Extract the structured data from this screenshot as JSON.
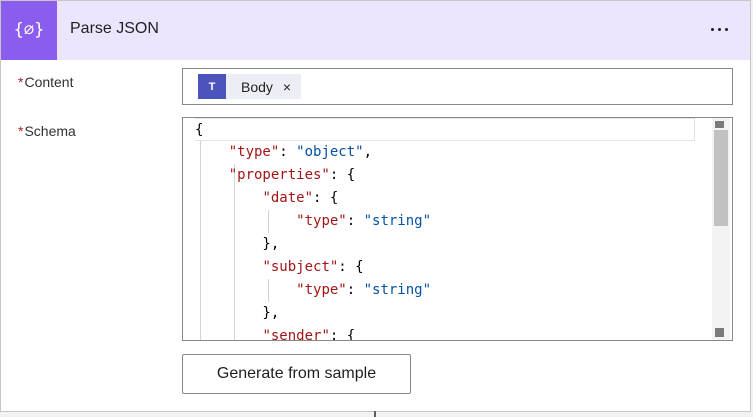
{
  "header": {
    "icon_glyph": "{⌀}",
    "title": "Parse JSON",
    "menu_icon": "more-horizontal-icon"
  },
  "fields": {
    "content": {
      "required_mark": "*",
      "label": "Content",
      "token": {
        "icon": "teams-icon",
        "label": "Body",
        "remove_glyph": "×"
      }
    },
    "schema": {
      "required_mark": "*",
      "label": "Schema",
      "code_lines": [
        [
          {
            "t": "p",
            "v": "{"
          }
        ],
        [
          {
            "t": "p",
            "v": "    "
          },
          {
            "t": "k",
            "v": "\"type\""
          },
          {
            "t": "p",
            "v": ": "
          },
          {
            "t": "s",
            "v": "\"object\""
          },
          {
            "t": "p",
            "v": ","
          }
        ],
        [
          {
            "t": "p",
            "v": "    "
          },
          {
            "t": "k",
            "v": "\"properties\""
          },
          {
            "t": "p",
            "v": ": {"
          }
        ],
        [
          {
            "t": "p",
            "v": "        "
          },
          {
            "t": "k",
            "v": "\"date\""
          },
          {
            "t": "p",
            "v": ": {"
          }
        ],
        [
          {
            "t": "p",
            "v": "            "
          },
          {
            "t": "k",
            "v": "\"type\""
          },
          {
            "t": "p",
            "v": ": "
          },
          {
            "t": "s",
            "v": "\"string\""
          }
        ],
        [
          {
            "t": "p",
            "v": "        },"
          }
        ],
        [
          {
            "t": "p",
            "v": "        "
          },
          {
            "t": "k",
            "v": "\"subject\""
          },
          {
            "t": "p",
            "v": ": {"
          }
        ],
        [
          {
            "t": "p",
            "v": "            "
          },
          {
            "t": "k",
            "v": "\"type\""
          },
          {
            "t": "p",
            "v": ": "
          },
          {
            "t": "s",
            "v": "\"string\""
          }
        ],
        [
          {
            "t": "p",
            "v": "        },"
          }
        ],
        [
          {
            "t": "p",
            "v": "        "
          },
          {
            "t": "k",
            "v": "\"sender\""
          },
          {
            "t": "p",
            "v": ": {"
          }
        ]
      ]
    }
  },
  "generate_button_label": "Generate from sample",
  "colors": {
    "accent": "#8a5dee",
    "header_bg": "#ebe6fd",
    "teams": "#4b53bc",
    "json_key": "#a31515",
    "json_string": "#0451a5",
    "required": "#a4262c"
  }
}
